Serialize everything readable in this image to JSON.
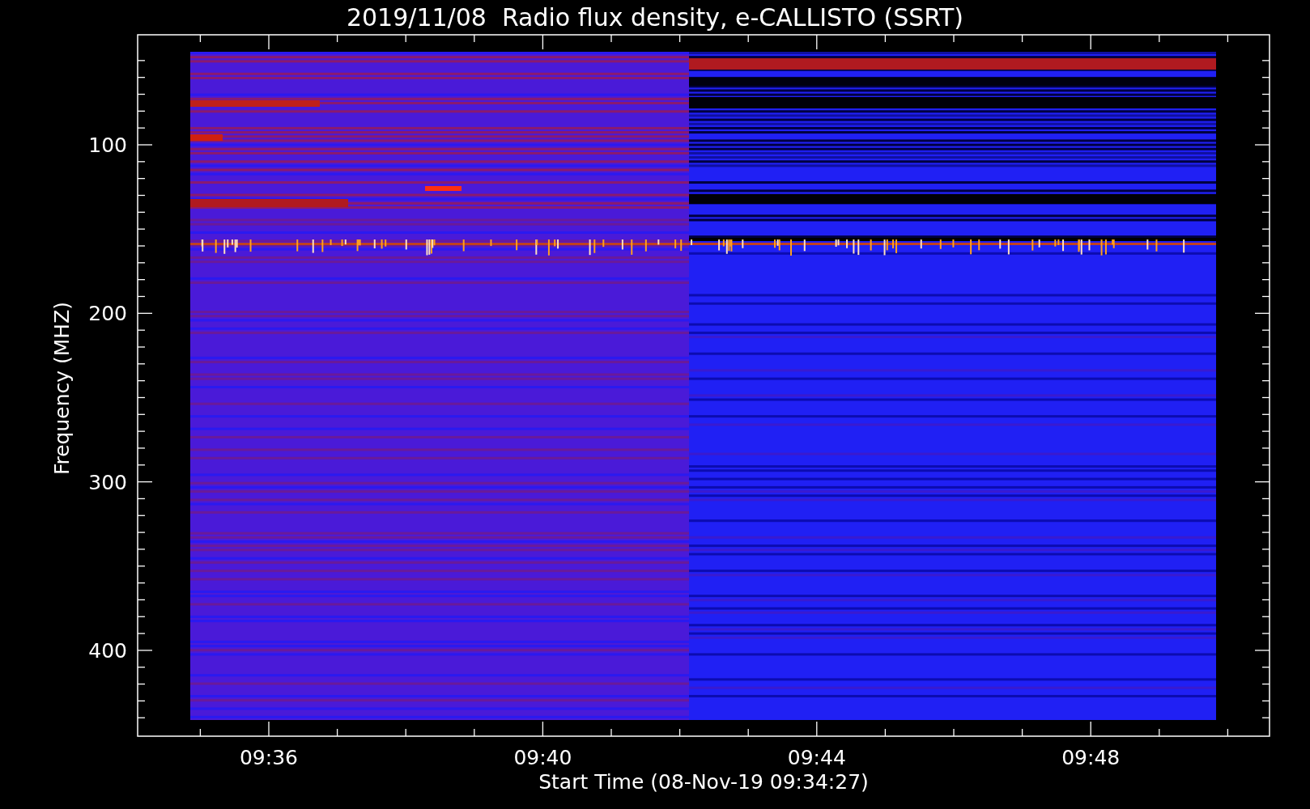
{
  "title": "2019/11/08  Radio flux density, e-CALLISTO (SSRT)",
  "y_axis": {
    "title": "Frequency (MHZ)",
    "ticks": [
      "100",
      "200",
      "300",
      "400"
    ]
  },
  "x_axis": {
    "title": "Start Time (08-Nov-19 09:34:27)",
    "ticks": [
      "09:36",
      "09:40",
      "09:44",
      "09:48"
    ]
  }
}
